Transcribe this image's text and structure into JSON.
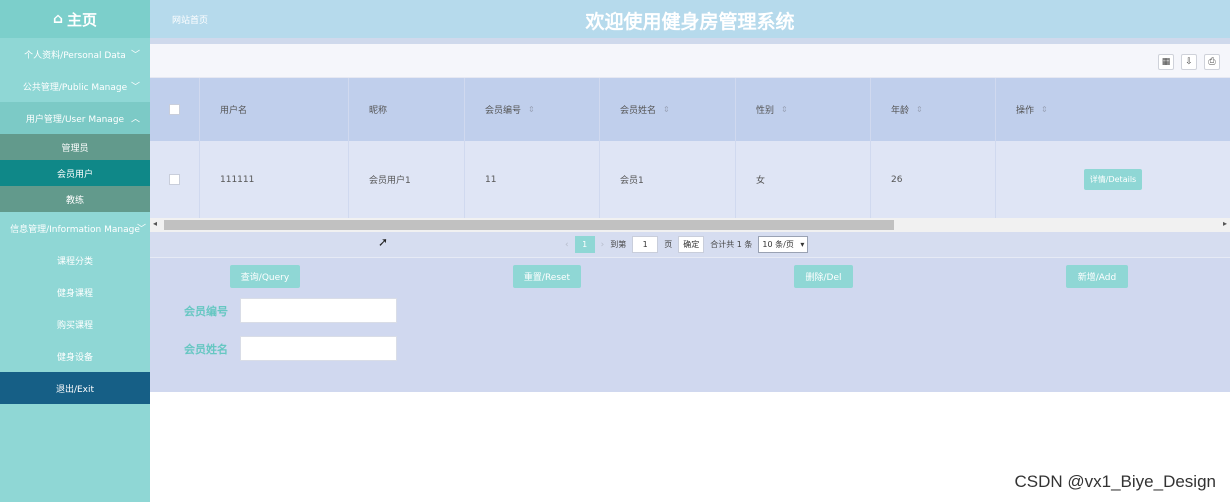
{
  "sidebar": {
    "brand": "主页",
    "menus": [
      {
        "label": "个人资料/Personal Data"
      },
      {
        "label": "公共管理/Public Manage"
      },
      {
        "label": "用户管理/User Manage"
      }
    ],
    "user_sub": [
      {
        "label": "管理员"
      },
      {
        "label": "会员用户"
      },
      {
        "label": "教练"
      }
    ],
    "info_menu": {
      "label": "信息管理/Information Manage"
    },
    "info_sub": [
      {
        "label": "课程分类"
      },
      {
        "label": "健身课程"
      },
      {
        "label": "购买课程"
      },
      {
        "label": "健身设备"
      }
    ],
    "exit": "退出/Exit"
  },
  "header": {
    "site_home": "网站首页",
    "title": "欢迎使用健身房管理系统"
  },
  "table": {
    "columns": [
      {
        "label": "用户名",
        "sortable": false
      },
      {
        "label": "昵称",
        "sortable": false
      },
      {
        "label": "会员编号",
        "sortable": true
      },
      {
        "label": "会员姓名",
        "sortable": true
      },
      {
        "label": "性别",
        "sortable": true
      },
      {
        "label": "年龄",
        "sortable": true
      },
      {
        "label": "操作",
        "sortable": true
      }
    ],
    "rows": [
      {
        "username": "111111",
        "nickname": "会员用户1",
        "member_no": "11",
        "member_name": "会员1",
        "gender": "女",
        "age": "26",
        "action": "详情/Details"
      }
    ]
  },
  "pagination": {
    "current": "1",
    "goto_prefix": "到第",
    "goto_value": "1",
    "goto_suffix": "页",
    "confirm": "确定",
    "total": "合计共 1 条",
    "page_size": "10 条/页"
  },
  "actions": {
    "query": "查询/Query",
    "reset": "重置/Reset",
    "delete": "删除/Del",
    "add": "新增/Add"
  },
  "search_form": {
    "member_no_label": "会员编号",
    "member_name_label": "会员姓名"
  },
  "watermark": "CSDN @vx1_Biye_Design",
  "colors": {
    "sidebar": "#8fd7d5",
    "active": "#0f8888",
    "exit": "#165f86",
    "header": "#b6daec",
    "accent": "#66c7c2"
  }
}
